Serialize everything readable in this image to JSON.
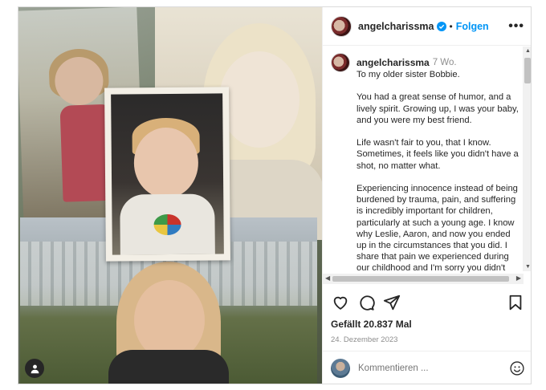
{
  "post": {
    "username": "angelcharissma",
    "follow_label": "Folgen",
    "more_label": "•••",
    "separator": "•"
  },
  "caption": {
    "username": "angelcharissma",
    "ago": "7 Wo.",
    "paragraphs": [
      "To my older sister Bobbie.",
      "You had a great sense of humor, and a lively spirit. Growing up, I was your baby, and you were my best friend.",
      "Life wasn't fair to you, that I know. Sometimes, it feels like you didn't have a shot, no matter what.",
      "Experiencing innocence instead of being burdened by trauma, pain, and suffering is incredibly important for children, particularly at such a young age. I know why Leslie, Aaron, and now you ended up in the circumstances that you did. I share that pain we experienced during our childhood and I'm sorry you didn't have an"
    ]
  },
  "scrollbars": {
    "up": "▲",
    "down": "▼",
    "left": "◀",
    "right": "▶"
  },
  "engagement": {
    "likes": "Gefällt 20.837 Mal",
    "date": "24. Dezember 2023"
  },
  "comment": {
    "placeholder": "Kommentieren ..."
  },
  "icons": {
    "verified": "verified-badge-icon",
    "like": "heart-icon",
    "comment": "comment-bubble-icon",
    "share": "paper-plane-icon",
    "save": "bookmark-icon",
    "emoji": "smiley-icon",
    "user_tag": "person-icon"
  },
  "colors": {
    "accent": "#0095f6",
    "text": "#262626",
    "muted": "#8e8e8e",
    "border": "#dbdbdb"
  }
}
